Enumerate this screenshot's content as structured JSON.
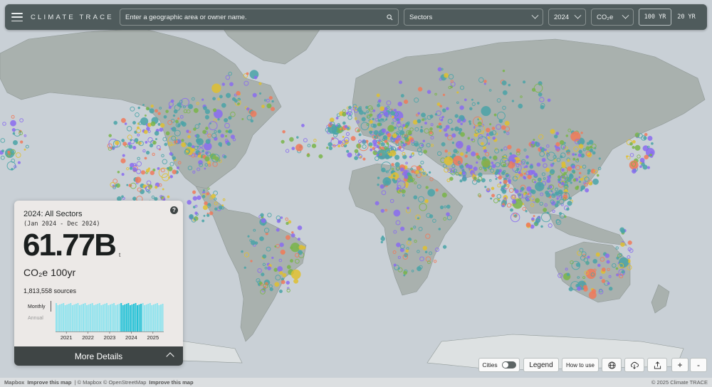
{
  "header": {
    "brand": "CLIMATE TRACE",
    "search_placeholder": "Enter a geographic area or owner name.",
    "sectors_label": "Sectors",
    "year_label": "2024",
    "gas_label": "CO₂e",
    "gwp_options": [
      "100 YR",
      "20 YR"
    ],
    "gwp_active": "100 YR"
  },
  "summary": {
    "title": "2024: All Sectors",
    "subtitle": "(Jan 2024 - Dec 2024)",
    "value": "61.77B",
    "unit": "t",
    "gas_label": "CO₂e 100yr",
    "sources": "1,813,558 sources",
    "toggle_monthly": "Monthly",
    "toggle_annual": "Annual",
    "help": "?",
    "more_details": "More Details"
  },
  "chart_data": {
    "type": "bar",
    "xlabel": "",
    "ylabel": "",
    "tick_labels": [
      "2021",
      "2022",
      "2023",
      "2024",
      "2025"
    ],
    "bar_count": 60,
    "highlight_range": [
      36,
      47
    ],
    "colors": {
      "normal": "#8fe3ee",
      "highlight": "#27c3d8"
    }
  },
  "controls": {
    "cities_label": "Cities",
    "legend_label": "Legend",
    "how_to_use_label": "How to use",
    "zoom_in": "+",
    "zoom_out": "-"
  },
  "attribution": {
    "mapbox_logo": "Mapbox",
    "improve1": "Improve this map",
    "credits": "| © Mapbox © OpenStreetMap",
    "improve2": "Improve this map",
    "copyright": "© 2025 Climate TRACE"
  },
  "colors": {
    "ocean": "#c9d0d6",
    "land": "#a8b0ad",
    "topbar": "#4f5b5c",
    "emission_teal": "#4aa4a8",
    "emission_purple": "#8a6cf0",
    "emission_orange": "#f07a5b",
    "emission_yellow": "#e0c030",
    "emission_green": "#7ab54a"
  }
}
